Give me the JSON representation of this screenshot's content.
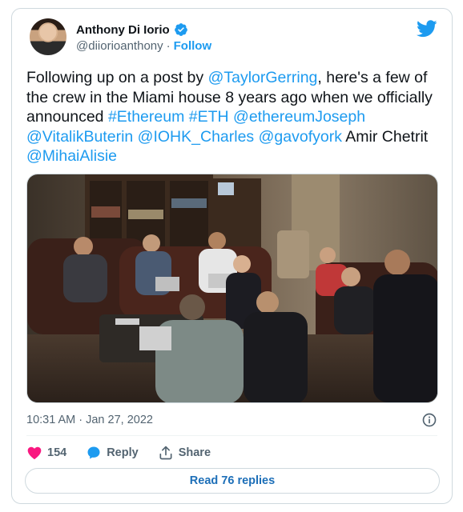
{
  "author": {
    "display_name": "Anthony Di Iorio",
    "handle": "@diiorioanthony",
    "separator": "·",
    "follow_label": "Follow",
    "verified": true
  },
  "tweet": {
    "text_parts": [
      {
        "t": "text",
        "v": "Following up on a post by "
      },
      {
        "t": "mention",
        "v": "@TaylorGerring"
      },
      {
        "t": "text",
        "v": ", here's a few of the crew in the Miami house 8 years ago when we officially announced "
      },
      {
        "t": "hashtag",
        "v": "#Ethereum"
      },
      {
        "t": "text",
        "v": " "
      },
      {
        "t": "hashtag",
        "v": "#ETH"
      },
      {
        "t": "text",
        "v": " "
      },
      {
        "t": "mention",
        "v": "@ethereumJoseph"
      },
      {
        "t": "text",
        "v": " "
      },
      {
        "t": "mention",
        "v": "@VitalikButerin"
      },
      {
        "t": "text",
        "v": " "
      },
      {
        "t": "mention",
        "v": "@IOHK_Charles"
      },
      {
        "t": "text",
        "v": " "
      },
      {
        "t": "mention",
        "v": "@gavofyork"
      },
      {
        "t": "text",
        "v": " Amir Chetrit "
      },
      {
        "t": "mention",
        "v": "@MihaiAlisie"
      }
    ]
  },
  "meta": {
    "time": "10:31 AM",
    "separator": "·",
    "date": "Jan 27, 2022"
  },
  "actions": {
    "like_count": "154",
    "reply_label": "Reply",
    "share_label": "Share"
  },
  "read_replies_label": "Read 76 replies",
  "colors": {
    "accent": "#1d9bf0",
    "like": "#f91880",
    "text": "#0f1419",
    "muted": "#536471"
  },
  "icons": [
    "verified-badge-icon",
    "twitter-bird-icon",
    "info-icon",
    "heart-icon",
    "reply-bubble-icon",
    "share-icon"
  ]
}
